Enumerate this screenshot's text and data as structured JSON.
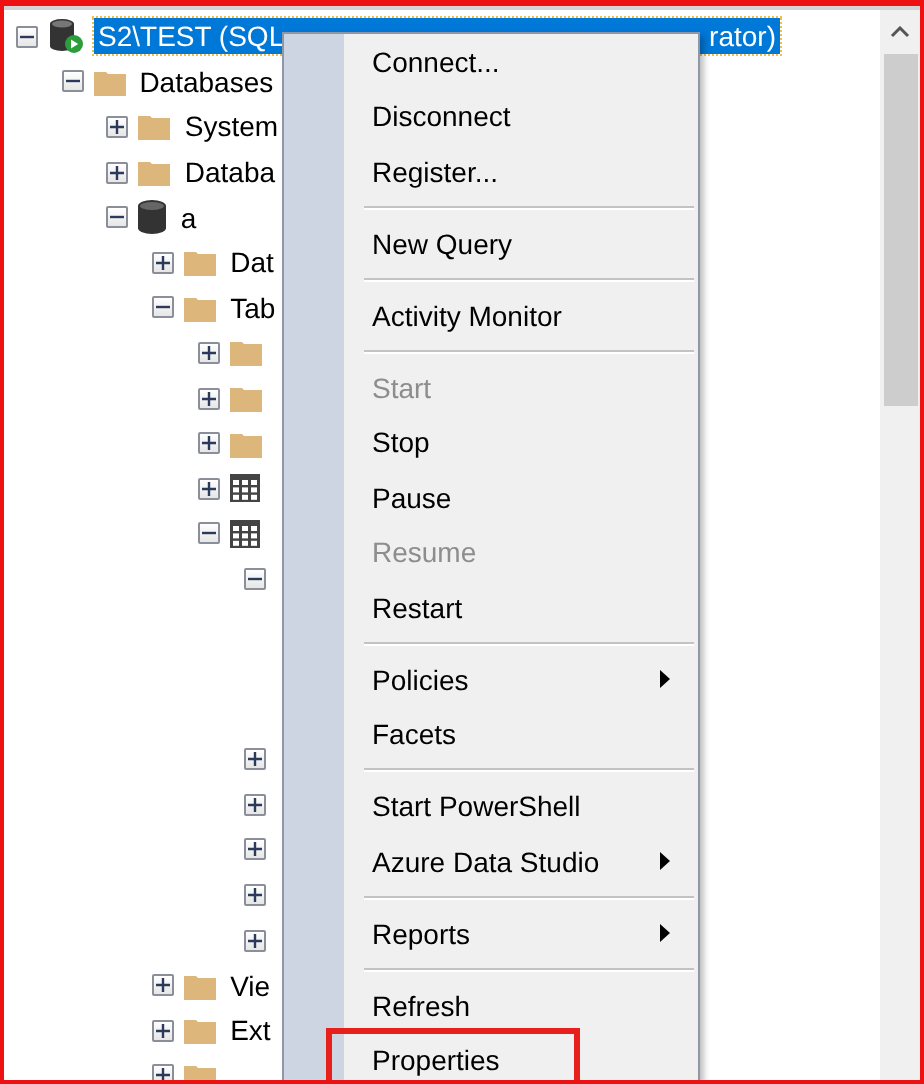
{
  "tree": [
    {
      "label": "S2\\TEST (SQL",
      "label_tail": "rator)",
      "kind": "server",
      "expanded": true,
      "selected": true,
      "children": [
        {
          "label": "Databases",
          "kind": "folder",
          "expanded": true,
          "selected": false,
          "children": [
            {
              "label": "System",
              "kind": "folder",
              "expanded": false,
              "selected": false
            },
            {
              "label": "Databa",
              "kind": "folder",
              "expanded": false,
              "selected": false
            },
            {
              "label": "a",
              "kind": "database",
              "expanded": true,
              "selected": false,
              "children": [
                {
                  "label": "Dat",
                  "kind": "folder",
                  "expanded": false,
                  "selected": false
                },
                {
                  "label": "Tab",
                  "kind": "folder",
                  "expanded": true,
                  "selected": false,
                  "children": [
                    {
                      "kind": "folder",
                      "expanded": false,
                      "selected": false
                    },
                    {
                      "kind": "folder",
                      "expanded": false,
                      "selected": false
                    },
                    {
                      "kind": "folder",
                      "expanded": false,
                      "selected": false
                    },
                    {
                      "kind": "table",
                      "expanded": false,
                      "selected": false
                    },
                    {
                      "kind": "table",
                      "expanded": true,
                      "selected": false,
                      "children": [
                        {
                          "expanded": true,
                          "selected": false
                        },
                        {
                          "expanded": false,
                          "selected": false
                        },
                        {
                          "expanded": false,
                          "selected": false
                        },
                        {
                          "expanded": false,
                          "selected": false
                        },
                        {
                          "expanded": false,
                          "selected": false
                        },
                        {
                          "expanded": false,
                          "selected": false
                        }
                      ]
                    }
                  ]
                },
                {
                  "label": "Vie",
                  "kind": "folder",
                  "expanded": false,
                  "selected": false
                },
                {
                  "label": "Ext",
                  "kind": "folder",
                  "expanded": false,
                  "selected": false
                },
                {
                  "kind": "folder",
                  "expanded": false,
                  "selected": false
                }
              ]
            }
          ]
        }
      ]
    }
  ],
  "context_menu": [
    {
      "kind": "item",
      "label": "Connect...",
      "disabled": false
    },
    {
      "kind": "item",
      "label": "Disconnect",
      "disabled": false
    },
    {
      "kind": "item",
      "label": "Register...",
      "disabled": false
    },
    {
      "kind": "separator"
    },
    {
      "kind": "item",
      "label": "New Query",
      "disabled": false
    },
    {
      "kind": "separator"
    },
    {
      "kind": "item",
      "label": "Activity Monitor",
      "disabled": false
    },
    {
      "kind": "separator"
    },
    {
      "kind": "item",
      "label": "Start",
      "disabled": true
    },
    {
      "kind": "item",
      "label": "Stop",
      "disabled": false
    },
    {
      "kind": "item",
      "label": "Pause",
      "disabled": false
    },
    {
      "kind": "item",
      "label": "Resume",
      "disabled": true
    },
    {
      "kind": "item",
      "label": "Restart",
      "disabled": false
    },
    {
      "kind": "separator"
    },
    {
      "kind": "submenu",
      "label": "Policies",
      "disabled": false
    },
    {
      "kind": "item",
      "label": "Facets",
      "disabled": false
    },
    {
      "kind": "separator"
    },
    {
      "kind": "item",
      "label": "Start PowerShell",
      "disabled": false
    },
    {
      "kind": "submenu",
      "label": "Azure Data Studio",
      "disabled": false
    },
    {
      "kind": "separator"
    },
    {
      "kind": "submenu",
      "label": "Reports",
      "disabled": false
    },
    {
      "kind": "separator"
    },
    {
      "kind": "item",
      "label": "Refresh",
      "disabled": false
    },
    {
      "kind": "item",
      "label": "Properties",
      "disabled": false,
      "highlighted": true
    }
  ]
}
